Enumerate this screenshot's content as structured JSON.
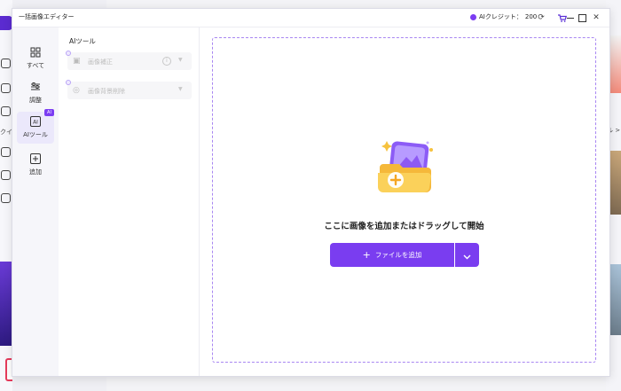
{
  "window": {
    "title": "一括画像エディター"
  },
  "titlebar": {
    "credit_label": "AIクレジット：",
    "credit_value": "200"
  },
  "nav": {
    "items": [
      {
        "label": "すべて"
      },
      {
        "label": "調整"
      },
      {
        "label": "AIツール",
        "badge": "AI"
      },
      {
        "label": "追加"
      }
    ]
  },
  "tools": {
    "title": "AIツール",
    "items": [
      {
        "label": "画像補正"
      },
      {
        "label": "画像背景削除"
      }
    ]
  },
  "dropzone": {
    "title": "ここに画像を追加またはドラッグして開始",
    "add_button": "ファイルを追加"
  },
  "background": {
    "fragment_left": "クイ",
    "fragment_right": "ル >"
  },
  "colors": {
    "accent": "#7a3df0",
    "dashed_border": "#a886f2"
  }
}
